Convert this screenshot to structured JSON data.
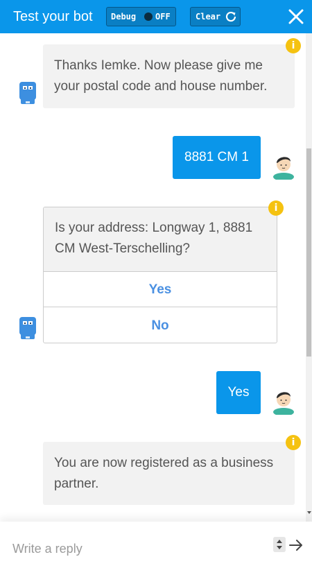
{
  "header": {
    "title": "Test your bot",
    "debug_label": "Debug",
    "debug_state": "OFF",
    "clear_label": "Clear"
  },
  "messages": [
    {
      "from": "bot",
      "text_lines": [
        "Thanks Iemke. Now please give me",
        "your postal code and house number."
      ]
    },
    {
      "from": "user",
      "text": "8881 CM 1"
    },
    {
      "from": "bot",
      "type": "choice",
      "text_lines": [
        "Is your address: Longway 1, 8881",
        "CM West-Terschelling?"
      ],
      "options": [
        "Yes",
        "No"
      ]
    },
    {
      "from": "user",
      "text": "Yes"
    },
    {
      "from": "bot",
      "text_lines": [
        "You are now registered as a business",
        "partner."
      ]
    }
  ],
  "footer": {
    "placeholder": "Write a reply"
  },
  "colors": {
    "header_bg": "#0a96ea",
    "user_bubble": "#0a96ea",
    "bot_bubble": "#f2f2f2",
    "info_icon": "#f5c211",
    "choice_button_text": "#4a90e2"
  },
  "icons": [
    "info-icon",
    "bot-avatar-icon",
    "user-avatar-icon",
    "refresh-icon",
    "close-icon",
    "send-arrow-icon",
    "stepper-icon"
  ]
}
